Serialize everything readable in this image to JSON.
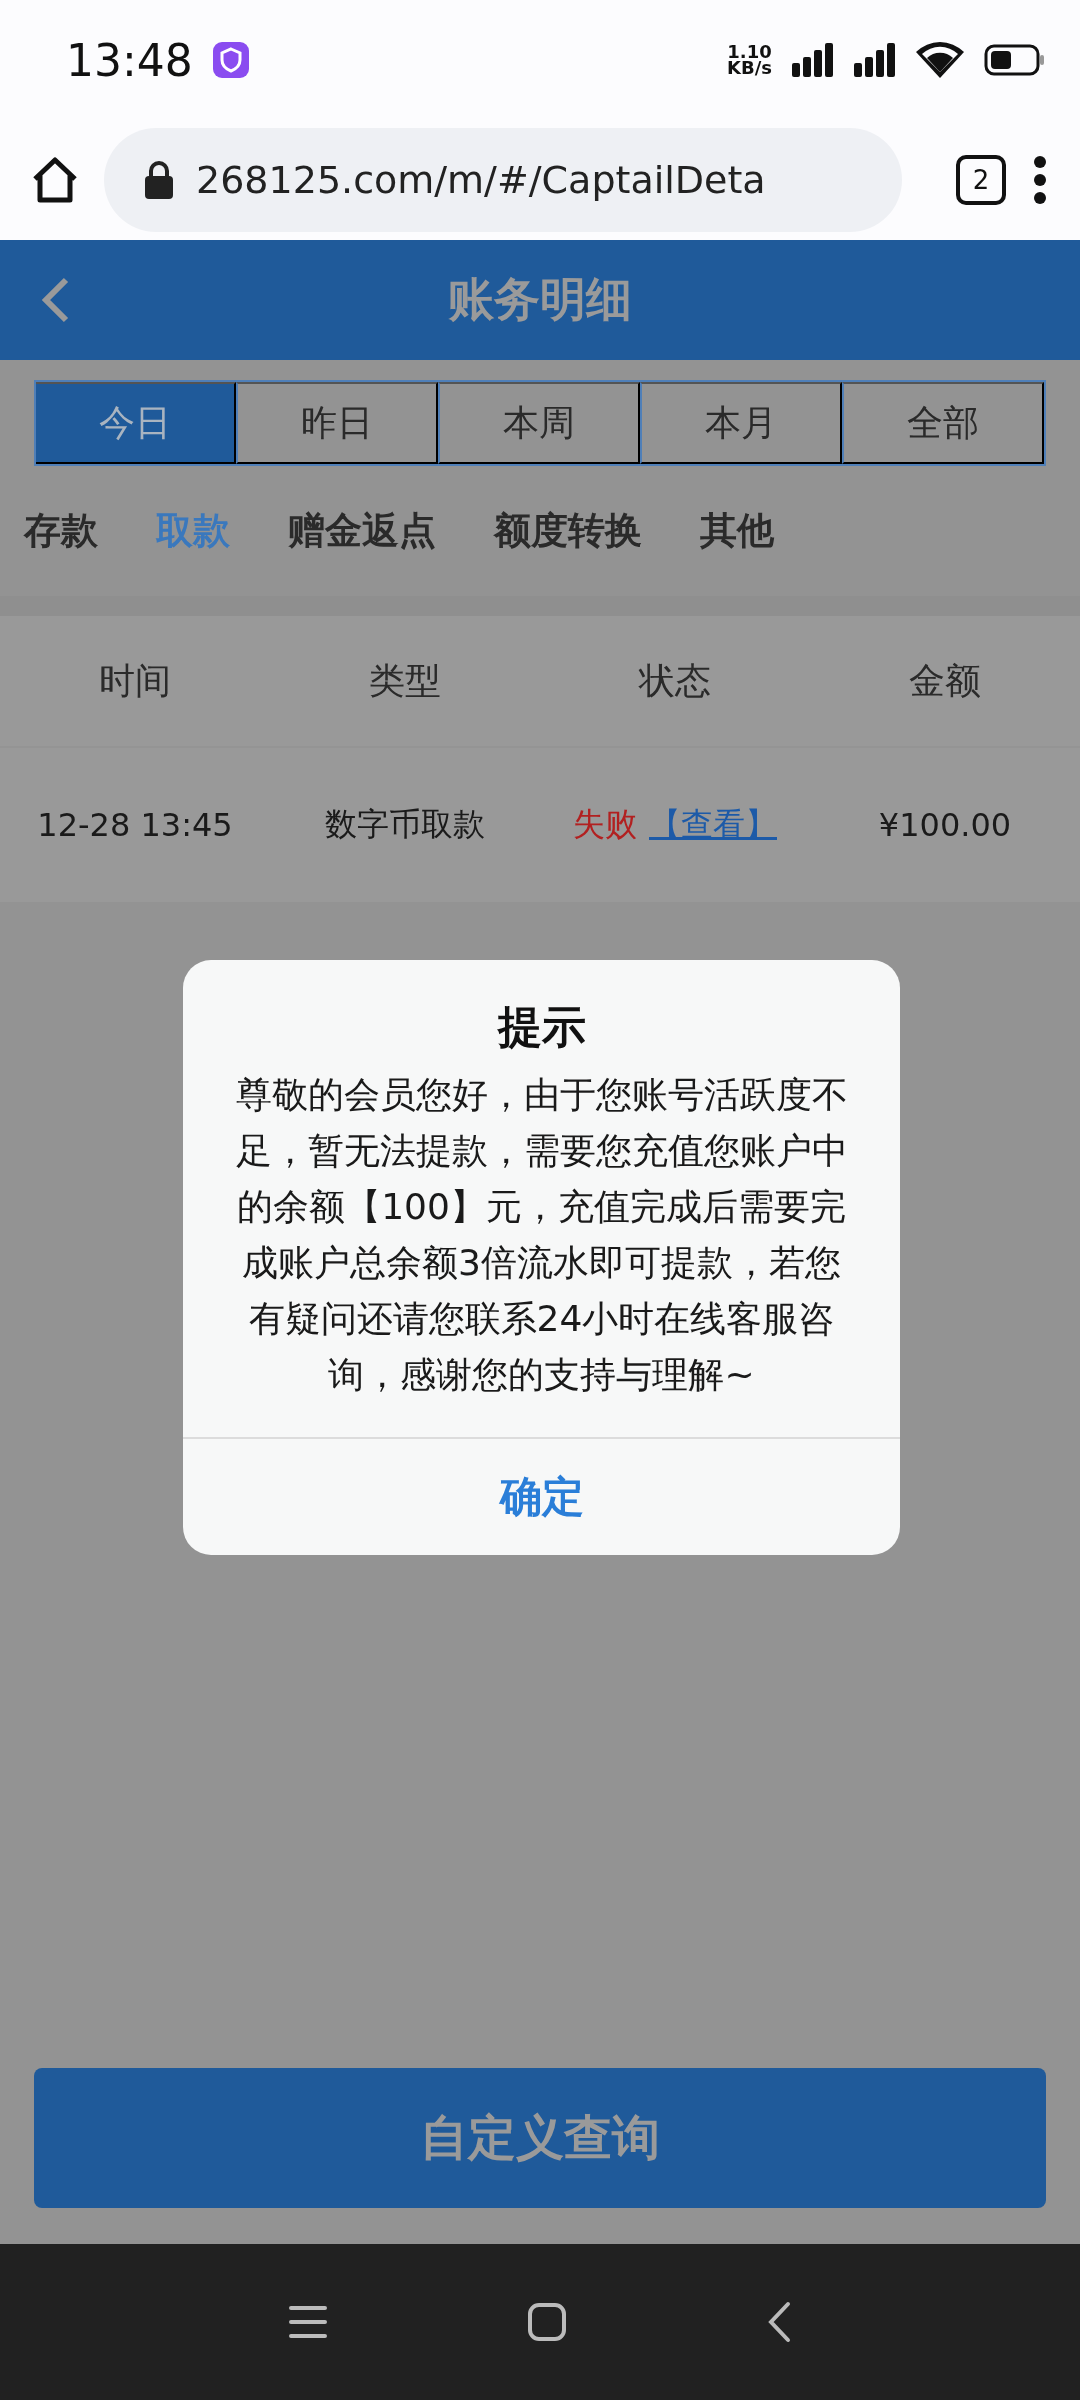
{
  "status_bar": {
    "time": "13:48",
    "net_speed_value": "1.10",
    "net_speed_unit": "KB/s"
  },
  "browser": {
    "url": "268125.com/m/#/CaptailDeta",
    "tab_count": "2"
  },
  "header": {
    "title": "账务明细"
  },
  "period_tabs": [
    {
      "label": "今日",
      "selected": true
    },
    {
      "label": "昨日",
      "selected": false
    },
    {
      "label": "本周",
      "selected": false
    },
    {
      "label": "本月",
      "selected": false
    },
    {
      "label": "全部",
      "selected": false
    }
  ],
  "categories": [
    {
      "label": "存款",
      "selected": false
    },
    {
      "label": "取款",
      "selected": true
    },
    {
      "label": "赠金返点",
      "selected": false
    },
    {
      "label": "额度转换",
      "selected": false
    },
    {
      "label": "其他",
      "selected": false
    }
  ],
  "table": {
    "columns": [
      "时间",
      "类型",
      "状态",
      "金额"
    ],
    "rows": [
      {
        "time": "12-28 13:45",
        "type": "数字币取款",
        "status": "失败",
        "link": "【查看】",
        "amount": "¥100.00"
      }
    ]
  },
  "dialog": {
    "title": "提示",
    "message": "尊敬的会员您好，由于您账号活跃度不足，暂无法提款，需要您充值您账户中的余额【100】元，充值完成后需要完成账户总余额3倍流水即可提款，若您有疑问还请您联系24小时在线客服咨询，感谢您的支持与理解~",
    "button": "确定"
  },
  "query_button": "自定义查询"
}
